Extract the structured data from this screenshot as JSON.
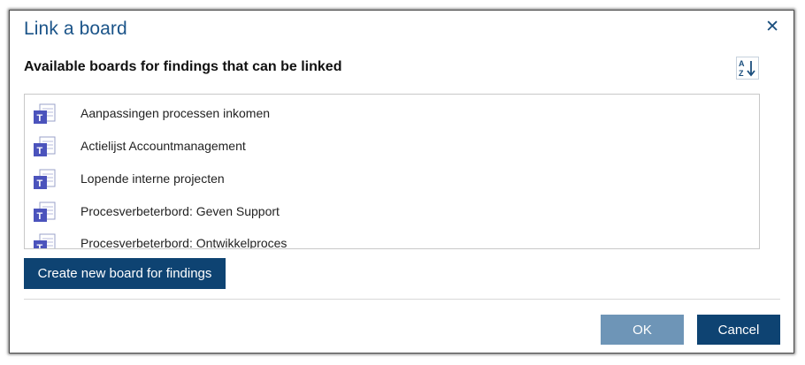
{
  "dialog": {
    "title": "Link a board",
    "close_icon": "close-icon"
  },
  "section": {
    "heading": "Available boards for findings that can be linked",
    "sort_icon": "sort-az-icon"
  },
  "boards": [
    {
      "label": "Aanpassingen processen inkomen",
      "icon": "teams-board-icon"
    },
    {
      "label": "Actielijst Accountmanagement",
      "icon": "teams-board-icon"
    },
    {
      "label": "Lopende interne projecten",
      "icon": "teams-board-icon"
    },
    {
      "label": "Procesverbeterbord: Geven Support",
      "icon": "teams-board-icon"
    },
    {
      "label": "Procesverbeterbord: Ontwikkelproces",
      "icon": "teams-board-icon"
    }
  ],
  "buttons": {
    "create": "Create new board for findings",
    "ok": "OK",
    "cancel": "Cancel"
  },
  "colors": {
    "title": "#1b5489",
    "primary_button": "#0e4372",
    "disabled_button": "#6e95b7",
    "board_icon": "#4b53bc"
  }
}
